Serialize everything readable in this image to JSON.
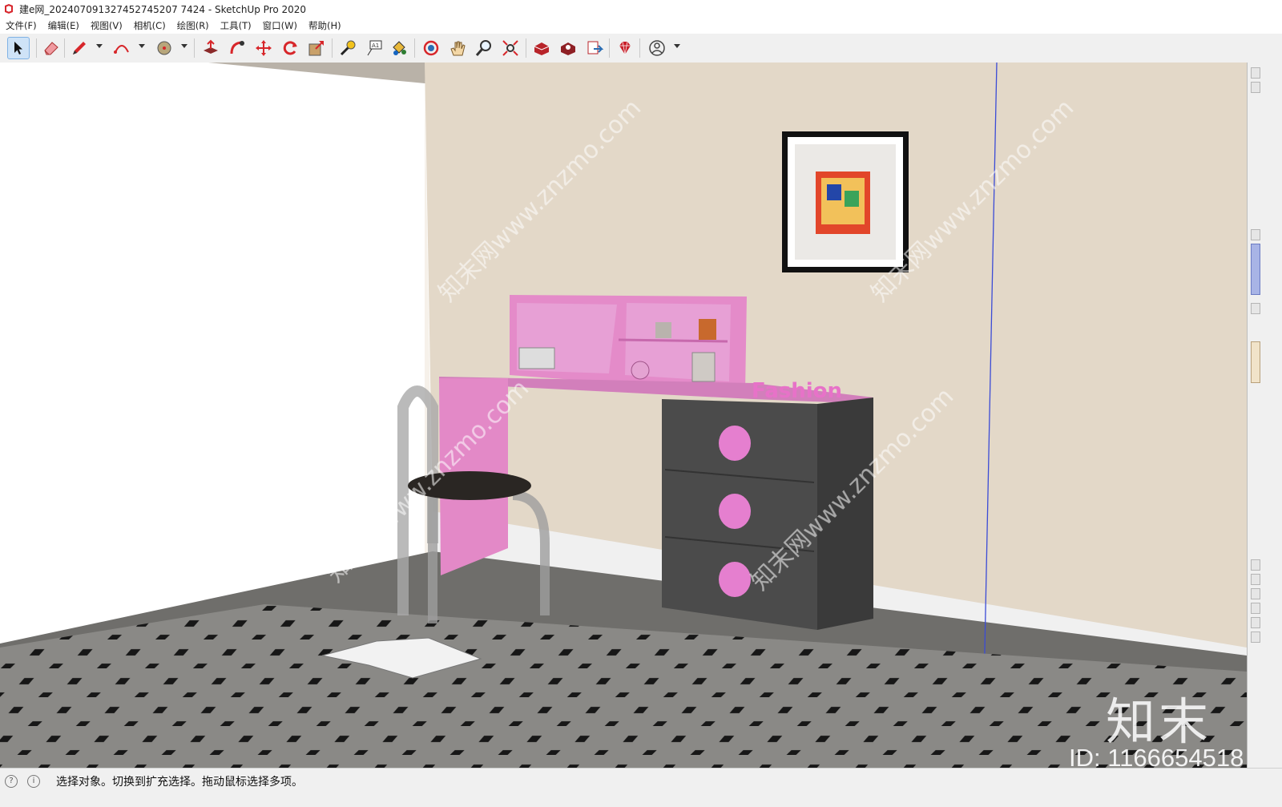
{
  "window": {
    "title": "建e网_202407091327452745207 7424 - SketchUp Pro 2020"
  },
  "menu": {
    "items": [
      "文件(F)",
      "编辑(E)",
      "视图(V)",
      "相机(C)",
      "绘图(R)",
      "工具(T)",
      "窗口(W)",
      "帮助(H)"
    ]
  },
  "toolbar": {
    "tools": [
      "select-tool",
      "eraser-tool",
      "pencil-tool",
      "arc-tool",
      "circle-tool",
      "pushpull-tool",
      "followme-tool",
      "move-tool",
      "rotate-tool",
      "scale-tool",
      "tape-tool",
      "text-tool",
      "paint-tool",
      "orbit-tool",
      "pan-tool",
      "zoom-tool",
      "zoom-extents-tool",
      "warehouse-tool",
      "extension-warehouse-tool",
      "send-to-layout-tool",
      "ruby-console-tool",
      "account-tool"
    ]
  },
  "scene": {
    "shelf_sign": "Fashion",
    "watermark_site": "知末网www.znzmo.com",
    "logo_text": "知末",
    "id_text": "ID: 1166654518"
  },
  "status": {
    "text": "选择对象。切换到扩充选择。拖动鼠标选择多项。"
  },
  "colors": {
    "wall": "#e3d8c8",
    "floor": "#777674",
    "desk_pink": "#e389c7",
    "drawer_gray": "#4b4b4b",
    "knob_pink": "#e57fcf",
    "accent_blue": "#7fb2e5"
  }
}
